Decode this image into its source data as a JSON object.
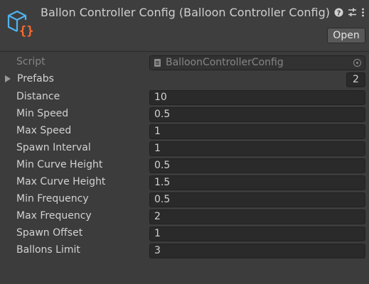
{
  "header": {
    "title": "Ballon Controller Config (Balloon Controller Config)",
    "open_label": "Open",
    "icons": [
      "script-icon",
      "help-icon",
      "preset-icon",
      "kebab-menu-icon"
    ]
  },
  "script_field": {
    "label": "Script",
    "value": "BalloonControllerConfig"
  },
  "prefabs": {
    "label": "Prefabs",
    "size": "2",
    "expanded": false
  },
  "fields": [
    {
      "label": "Distance",
      "value": "10"
    },
    {
      "label": "Min Speed",
      "value": "0.5"
    },
    {
      "label": "Max Speed",
      "value": "1"
    },
    {
      "label": "Spawn Interval",
      "value": "1"
    },
    {
      "label": "Min Curve Height",
      "value": "0.5"
    },
    {
      "label": "Max Curve Height",
      "value": "1.5"
    },
    {
      "label": "Min Frequency",
      "value": "0.5"
    },
    {
      "label": "Max Frequency",
      "value": "2"
    },
    {
      "label": "Spawn Offset",
      "value": "1"
    },
    {
      "label": "Ballons Limit",
      "value": "3"
    }
  ],
  "colors": {
    "background": "#3c3c3c",
    "field_bg": "#2a2a2a",
    "icon_blue": "#4fb3f0",
    "icon_orange": "#ff6a2e"
  }
}
